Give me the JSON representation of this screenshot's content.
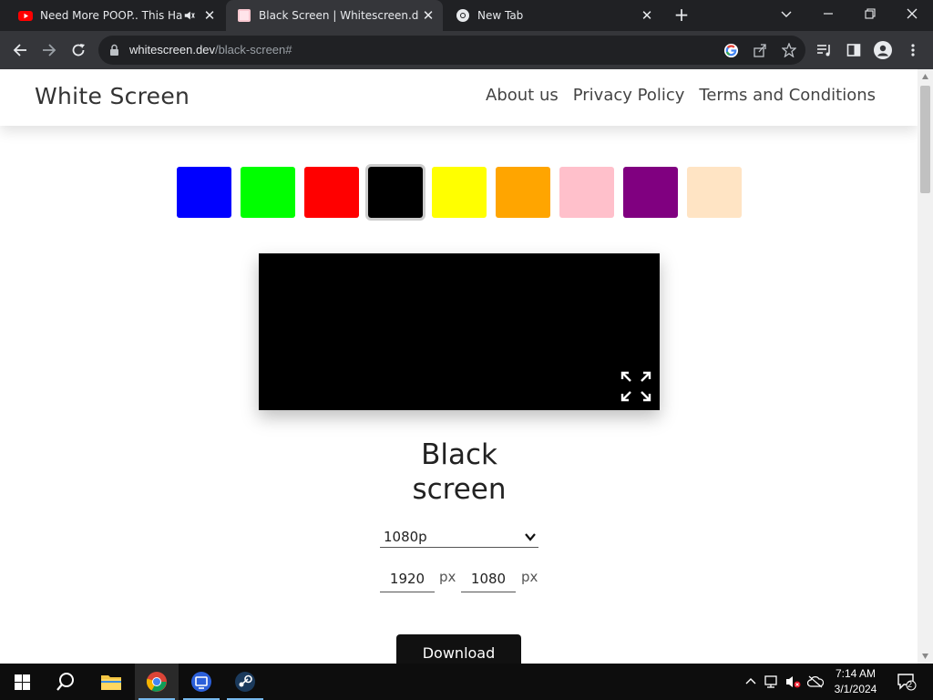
{
  "browser": {
    "tabs": [
      {
        "title": "Need More POOP.. This Has",
        "favicon": "youtube-icon",
        "muted": true
      },
      {
        "title": "Black Screen | Whitescreen.dev",
        "favicon": "whitescreen-favicon",
        "active": true
      },
      {
        "title": "New Tab",
        "favicon": "chrome-icon"
      }
    ],
    "url_domain": "whitescreen.dev",
    "url_path": "/black-screen#"
  },
  "site": {
    "brand": "White Screen",
    "nav": [
      "About us",
      "Privacy Policy",
      "Terms and Conditions"
    ],
    "swatches": [
      "#0000ff",
      "#00ff00",
      "#ff0000",
      "#000000",
      "#ffff00",
      "#ffa500",
      "#ffc0cb",
      "#800080",
      "#ffe4c4"
    ],
    "selected_swatch": "#000000",
    "preview_color": "#000000",
    "heading_line1": "Black",
    "heading_line2": "screen",
    "resolution": "1080p",
    "width": "1920",
    "height": "1080",
    "unit": "px",
    "download_label": "Download"
  },
  "taskbar": {
    "time": "7:14 AM",
    "date": "3/1/2024",
    "notification_count": "2"
  }
}
